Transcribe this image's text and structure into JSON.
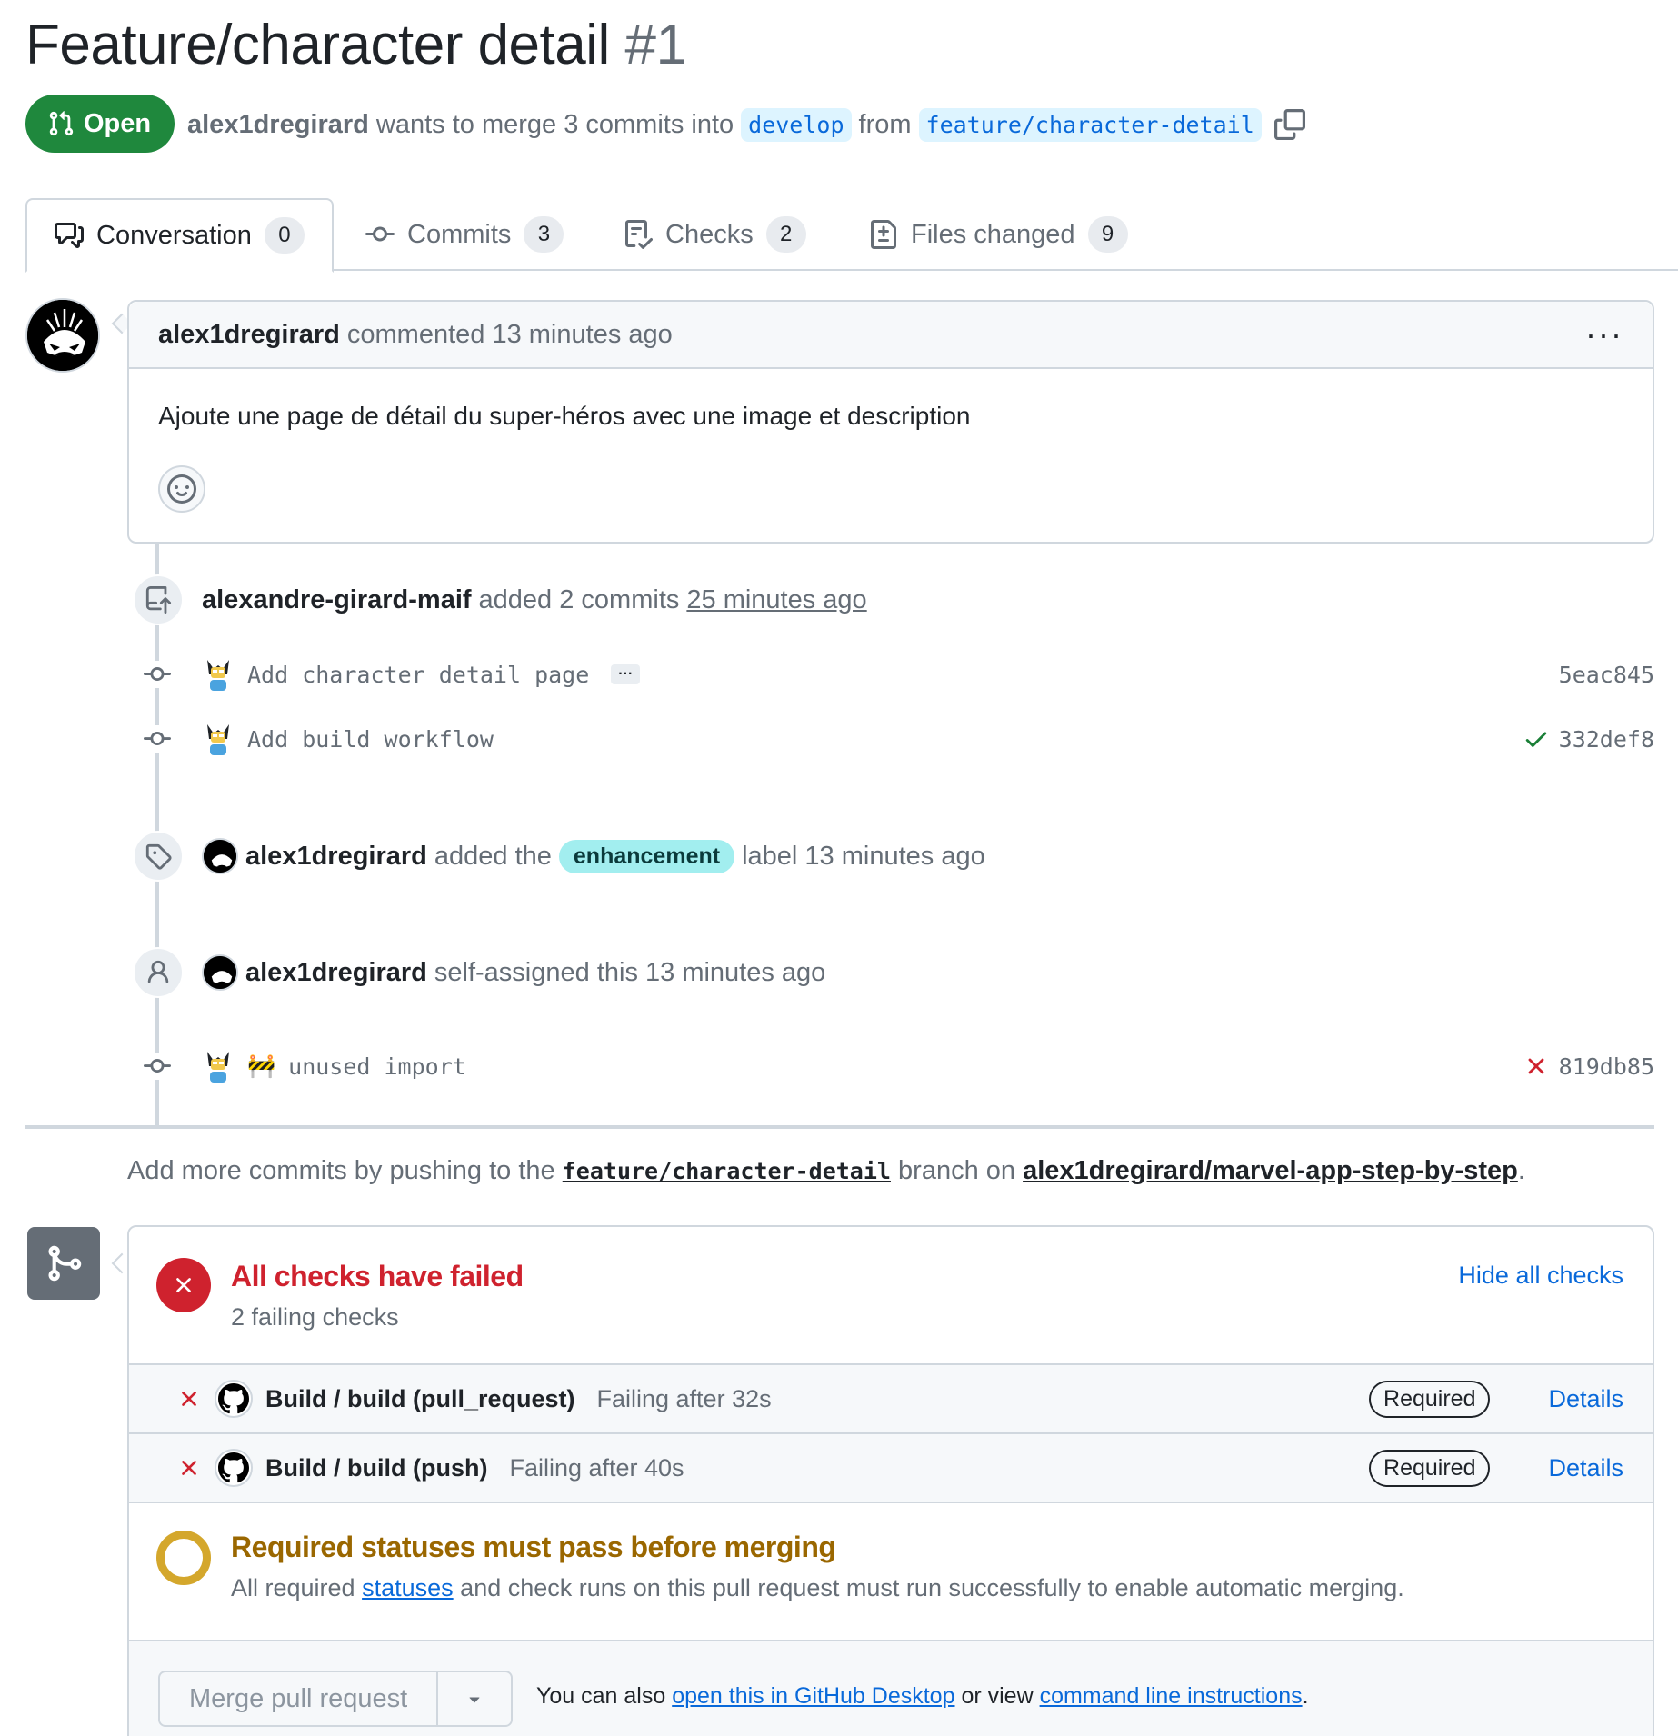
{
  "header": {
    "title": "Feature/character detail",
    "number": "#1",
    "state": "Open",
    "author": "alex1dregirard",
    "merge_text": "wants to merge 3 commits into",
    "base_branch": "develop",
    "from_text": "from",
    "head_branch": "feature/character-detail"
  },
  "tabs": [
    {
      "label": "Conversation",
      "count": "0",
      "icon": "comment-discussion-icon"
    },
    {
      "label": "Commits",
      "count": "3",
      "icon": "git-commit-icon"
    },
    {
      "label": "Checks",
      "count": "2",
      "icon": "checklist-icon"
    },
    {
      "label": "Files changed",
      "count": "9",
      "icon": "file-diff-icon"
    }
  ],
  "comment": {
    "author": "alex1dregirard",
    "meta": "commented 13 minutes ago",
    "body": "Ajoute une page de détail du super-héros avec une image et description"
  },
  "events": {
    "push": {
      "author": "alexandre-girard-maif",
      "text": "added 2 commits",
      "time": "25 minutes ago"
    },
    "commits": [
      {
        "message": "Add character detail page",
        "sha": "5eac845",
        "status": "none"
      },
      {
        "message": "Add build workflow",
        "sha": "332def8",
        "status": "success"
      }
    ],
    "label": {
      "author": "alex1dregirard",
      "pre": "added the",
      "label": "enhancement",
      "post": "label 13 minutes ago"
    },
    "assign": {
      "author": "alex1dregirard",
      "text": "self-assigned this 13 minutes ago"
    },
    "last_commit": {
      "emoji": "🚧",
      "message": "unused import",
      "sha": "819db85",
      "status": "failure"
    }
  },
  "push_hint": {
    "pre": "Add more commits by pushing to the",
    "branch": "feature/character-detail",
    "mid": "branch on",
    "repo": "alex1dregirard/marvel-app-step-by-step",
    "post": "."
  },
  "checks": {
    "title": "All checks have failed",
    "subtitle": "2 failing checks",
    "hide_label": "Hide all checks",
    "rows": [
      {
        "name": "Build / build (pull_request)",
        "status": "Failing after 32s",
        "badge": "Required",
        "link": "Details"
      },
      {
        "name": "Build / build (push)",
        "status": "Failing after 40s",
        "badge": "Required",
        "link": "Details"
      }
    ],
    "required": {
      "title": "Required statuses must pass before merging",
      "pre": "All required",
      "link": "statuses",
      "post": "and check runs on this pull request must run successfully to enable automatic merging."
    },
    "merge": {
      "button": "Merge pull request",
      "note_pre": "You can also",
      "desktop_link": "open this in GitHub Desktop",
      "note_mid": "or view",
      "cli_link": "command line instructions",
      "note_post": "."
    }
  },
  "colors": {
    "open_green": "#1f883d",
    "fail_red": "#cf222e",
    "pending_yellow": "#d4a72c",
    "link_blue": "#0969da",
    "label_bg": "#a2eeef"
  }
}
